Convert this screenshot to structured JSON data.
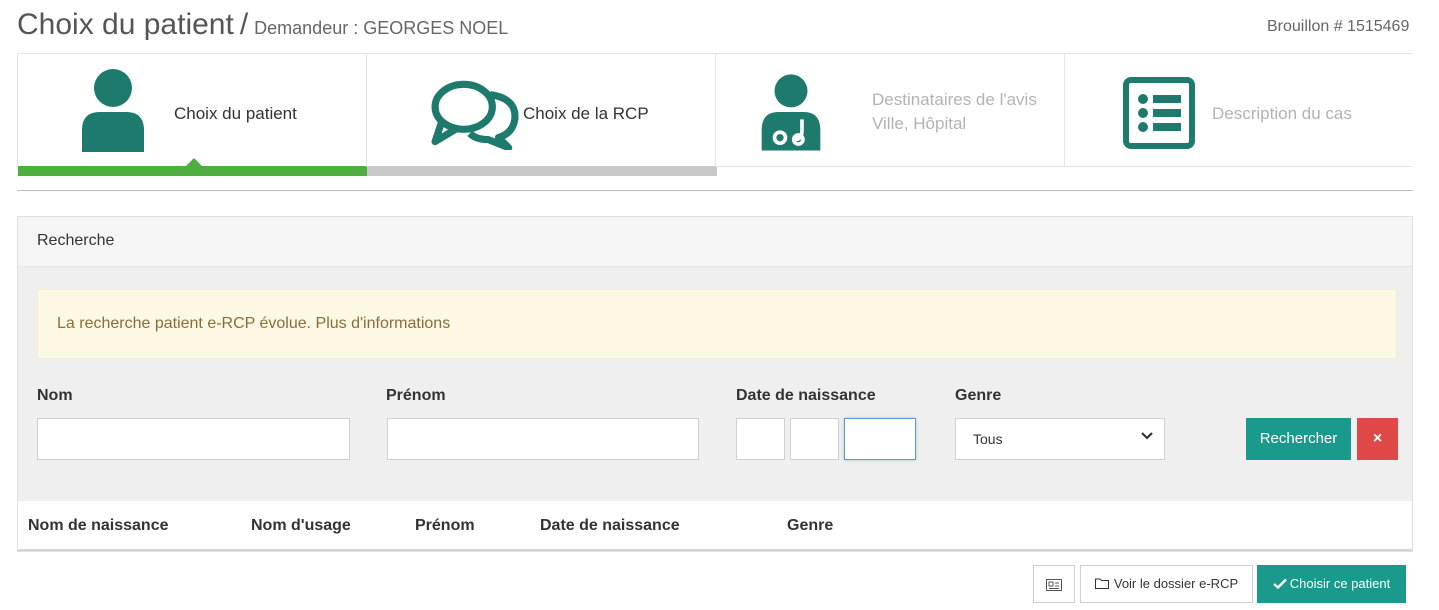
{
  "header": {
    "title": "Choix du patient",
    "separator": "/",
    "subtitle": "Demandeur : GEORGES NOEL",
    "draft": "Brouillon # 1515469"
  },
  "steps": [
    {
      "label": "Choix du patient",
      "icon": "patient-icon",
      "state": "active"
    },
    {
      "label": "Choix de la RCP",
      "icon": "chat-bubbles-icon",
      "state": "enabled"
    },
    {
      "label_line1": "Destinataires de l'avis",
      "label_line2": "Ville, Hôpital",
      "icon": "doctor-icon",
      "state": "disabled"
    },
    {
      "label": "Description du cas",
      "icon": "list-icon",
      "state": "disabled"
    }
  ],
  "search": {
    "panel_title": "Recherche",
    "alert": "La recherche patient e-RCP évolue. Plus d'informations",
    "labels": {
      "nom": "Nom",
      "prenom": "Prénom",
      "date": "Date de naissance",
      "genre": "Genre"
    },
    "values": {
      "nom": "",
      "prenom": "",
      "day": "",
      "month": "",
      "year": ""
    },
    "genre_selected": "Tous",
    "search_button": "Rechercher",
    "clear_button": "×"
  },
  "table": {
    "headers": [
      "Nom de naissance",
      "Nom d'usage",
      "Prénom",
      "Date de naissance",
      "Genre"
    ]
  },
  "footer": {
    "view_button": "Voir le dossier e-RCP",
    "choose_button": "Choisir ce patient"
  },
  "colors": {
    "teal": "#1a9a8c",
    "green_bar": "#4caf3e",
    "icon": "#1f7a6e",
    "danger": "#e04848",
    "alert_bg": "#fcf8e3"
  }
}
